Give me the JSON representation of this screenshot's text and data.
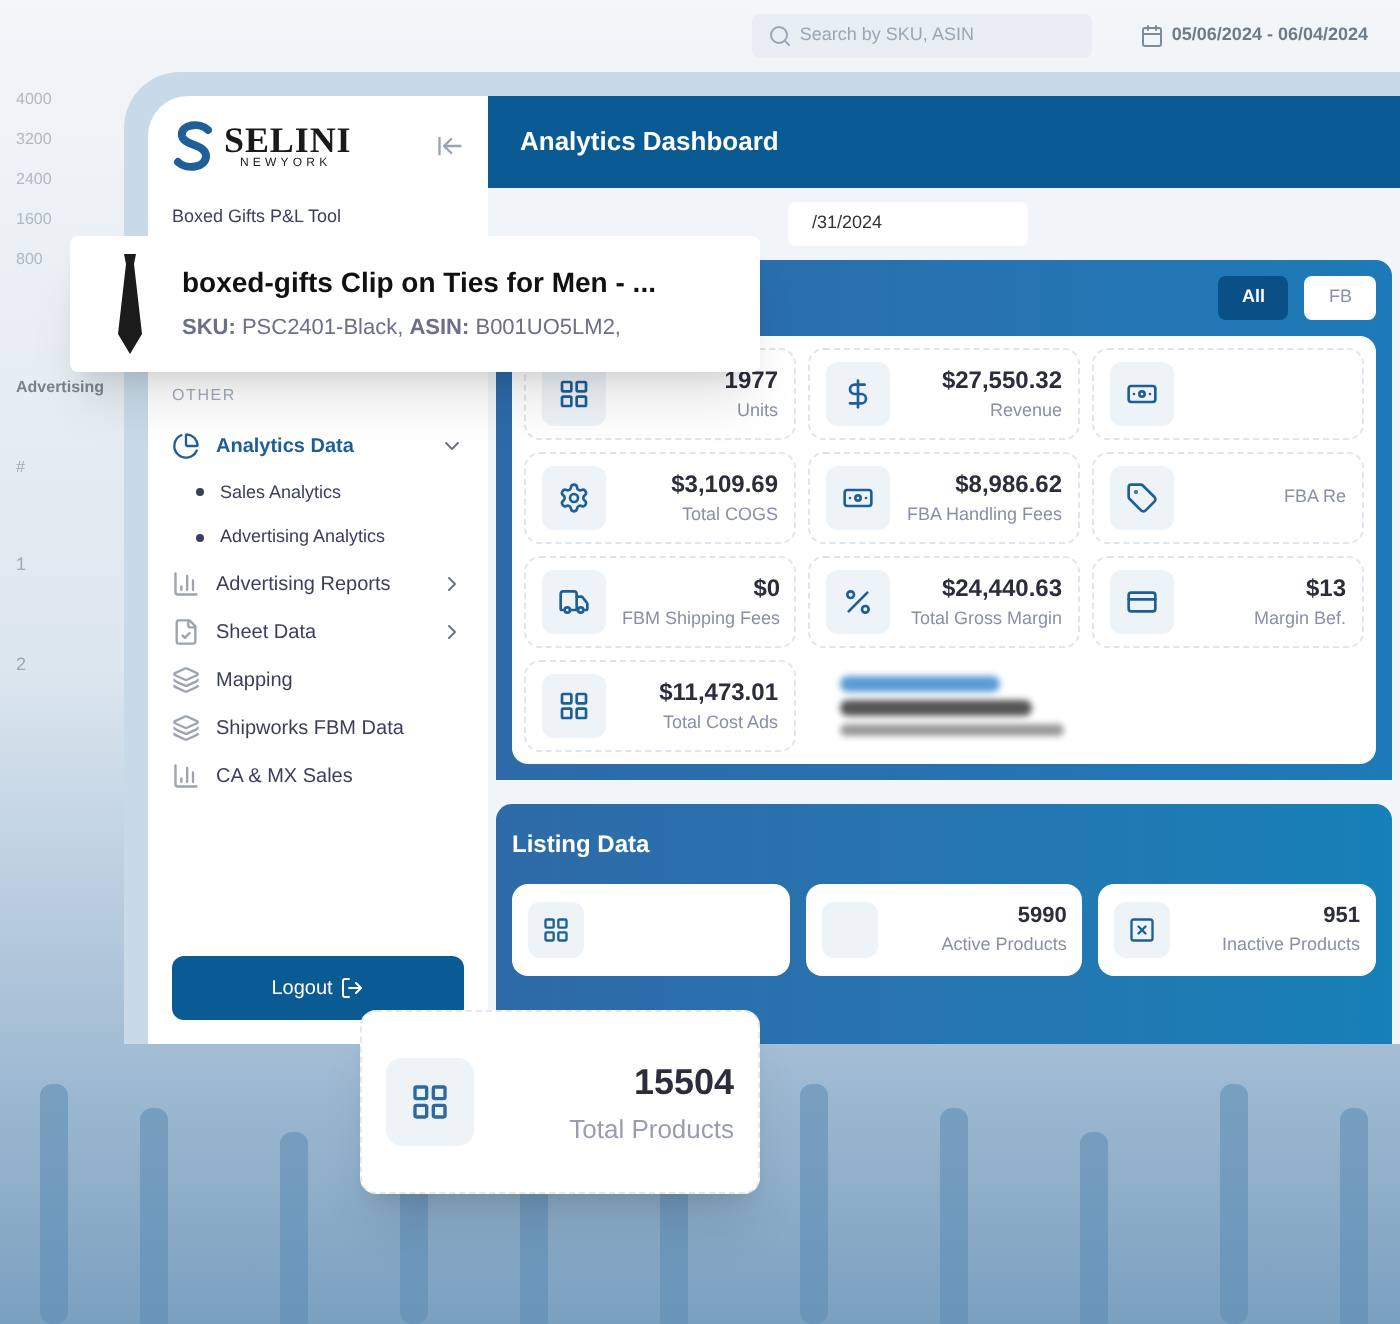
{
  "background": {
    "search_placeholder": "Search by SKU, ASIN",
    "date_range": "05/06/2024 - 06/04/2024",
    "chart_ticks": [
      "4000",
      "3200",
      "2400",
      "1600",
      "800"
    ],
    "table_title": "Advertising",
    "table_header": "#",
    "row_numbers": [
      "1",
      "2"
    ]
  },
  "sidebar": {
    "logo": {
      "name": "SELINI",
      "tagline": "NEWYORK"
    },
    "tool_name": "Boxed Gifts P&L Tool",
    "section_label": "OTHER",
    "items": [
      {
        "label": "Analytics Data",
        "selected": true,
        "expanded": true,
        "children": [
          {
            "label": "Sales Analytics"
          },
          {
            "label": "Advertising Analytics"
          }
        ]
      },
      {
        "label": "Advertising Reports",
        "selected": false,
        "expanded": false
      },
      {
        "label": "Sheet Data",
        "selected": false,
        "expanded": false
      },
      {
        "label": "Mapping",
        "selected": false
      },
      {
        "label": "Shipworks FBM Data",
        "selected": false
      },
      {
        "label": "CA & MX Sales",
        "selected": false
      }
    ],
    "logout": "Logout"
  },
  "header": {
    "title": "Analytics Dashboard"
  },
  "date_field": {
    "value": "/31/2024"
  },
  "filter_tabs": [
    {
      "label": "All",
      "selected": true
    },
    {
      "label": "FB",
      "selected": false
    }
  ],
  "stat_columns": [
    {
      "cards": [
        {
          "kind": "stat",
          "value": "1977",
          "label": "Units"
        },
        {
          "kind": "stat",
          "value": "$3,109.69",
          "label": "Total COGS"
        },
        {
          "kind": "stat",
          "value": "$0",
          "label": "FBM Shipping Fees"
        },
        {
          "kind": "stat",
          "value": "$11,473.01",
          "label": "Total Cost Ads"
        }
      ]
    },
    {
      "cards": [
        {
          "kind": "stat",
          "value": "$27,550.32",
          "label": "Revenue"
        },
        {
          "kind": "stat",
          "value": "$8,986.62",
          "label": "FBA Handling Fees"
        },
        {
          "kind": "stat",
          "value": "$24,440.63",
          "label": "Total Gross Margin"
        },
        {
          "kind": "best_seller"
        }
      ]
    },
    {
      "cards": [
        {
          "kind": "stat"
        },
        {
          "kind": "stat",
          "label": "FBA Re"
        },
        {
          "kind": "stat",
          "value": "$13",
          "label": "Margin Bef."
        }
      ]
    }
  ],
  "product_popup": {
    "title": "boxed-gifts Clip on Ties for Men - ...",
    "details": "**SKU:** PSC2401-Black, **ASIN:** B001UO5LM2,"
  },
  "listing": {
    "title": "Listing Data",
    "cards": [
      {
        "value": "5990",
        "label": "Active Products"
      },
      {
        "value": "951",
        "label": "Inactive Products"
      }
    ]
  },
  "total_products_popup": {
    "value": "15504",
    "label": "Total Products"
  }
}
